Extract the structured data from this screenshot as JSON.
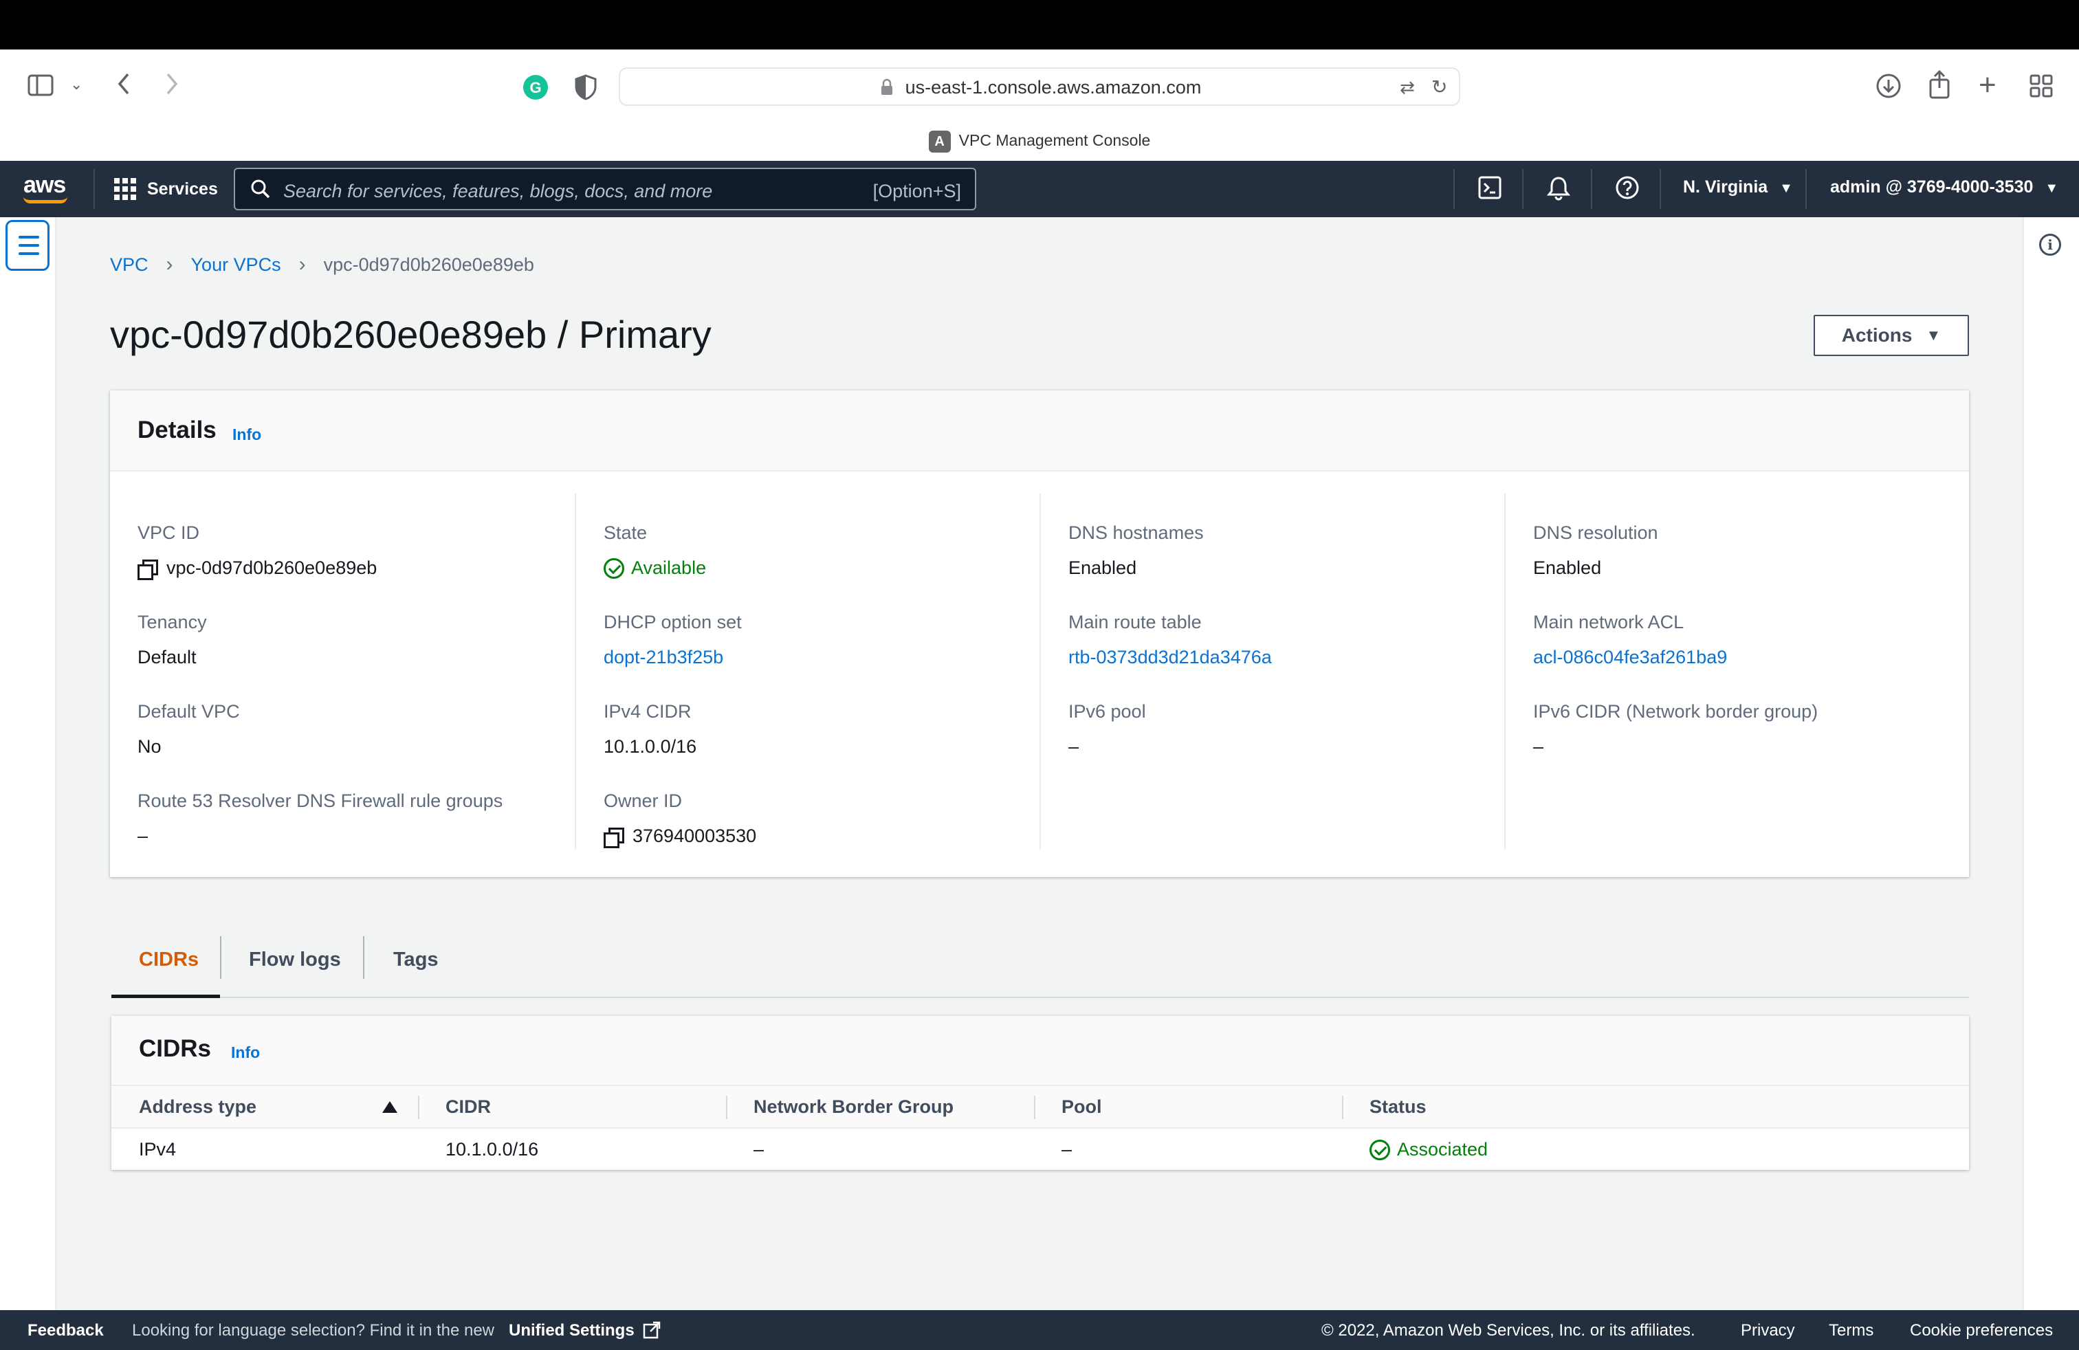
{
  "browser": {
    "url": "us-east-1.console.aws.amazon.com",
    "tab_title": "VPC Management Console",
    "tab_favicon": "A"
  },
  "aws_nav": {
    "logo": "aws",
    "services_label": "Services",
    "search_placeholder": "Search for services, features, blogs, docs, and more",
    "search_shortcut": "[Option+S]",
    "region": "N. Virginia",
    "account": "admin @ 3769-4000-3530"
  },
  "breadcrumb": {
    "items": [
      "VPC",
      "Your VPCs"
    ],
    "current": "vpc-0d97d0b260e0e89eb"
  },
  "page": {
    "title": "vpc-0d97d0b260e0e89eb / Primary",
    "actions_label": "Actions"
  },
  "details": {
    "title": "Details",
    "info_label": "Info",
    "columns": [
      [
        {
          "label": "VPC ID",
          "value": "vpc-0d97d0b260e0e89eb"
        },
        {
          "label": "Tenancy",
          "value": "Default"
        },
        {
          "label": "Default VPC",
          "value": "No"
        },
        {
          "label": "Route 53 Resolver DNS Firewall rule groups",
          "value": "–"
        }
      ],
      [
        {
          "label": "State",
          "value": "Available"
        },
        {
          "label": "DHCP option set",
          "value": "dopt-21b3f25b"
        },
        {
          "label": "IPv4 CIDR",
          "value": "10.1.0.0/16"
        },
        {
          "label": "Owner ID",
          "value": "376940003530"
        }
      ],
      [
        {
          "label": "DNS hostnames",
          "value": "Enabled"
        },
        {
          "label": "Main route table",
          "value": "rtb-0373dd3d21da3476a"
        },
        {
          "label": "IPv6 pool",
          "value": "–"
        }
      ],
      [
        {
          "label": "DNS resolution",
          "value": "Enabled"
        },
        {
          "label": "Main network ACL",
          "value": "acl-086c04fe3af261ba9"
        },
        {
          "label": "IPv6 CIDR (Network border group)",
          "value": "–"
        }
      ]
    ]
  },
  "tabs": [
    "CIDRs",
    "Flow logs",
    "Tags"
  ],
  "cidrs": {
    "title": "CIDRs",
    "info_label": "Info",
    "headers": [
      "Address type",
      "CIDR",
      "Network Border Group",
      "Pool",
      "Status"
    ],
    "rows": [
      [
        "IPv4",
        "10.1.0.0/16",
        "–",
        "–",
        "Associated"
      ]
    ]
  },
  "footer": {
    "feedback": "Feedback",
    "lang_prompt": "Looking for language selection? Find it in the new",
    "unified_settings": "Unified Settings",
    "copyright": "© 2022, Amazon Web Services, Inc. or its affiliates.",
    "privacy": "Privacy",
    "terms": "Terms",
    "cookie": "Cookie preferences"
  },
  "colors": {
    "nav_bg": "#232f3e",
    "link": "#0972d3",
    "success": "#037f0c",
    "active_tab": "#d45b07",
    "aws_orange": "#ff9900"
  }
}
